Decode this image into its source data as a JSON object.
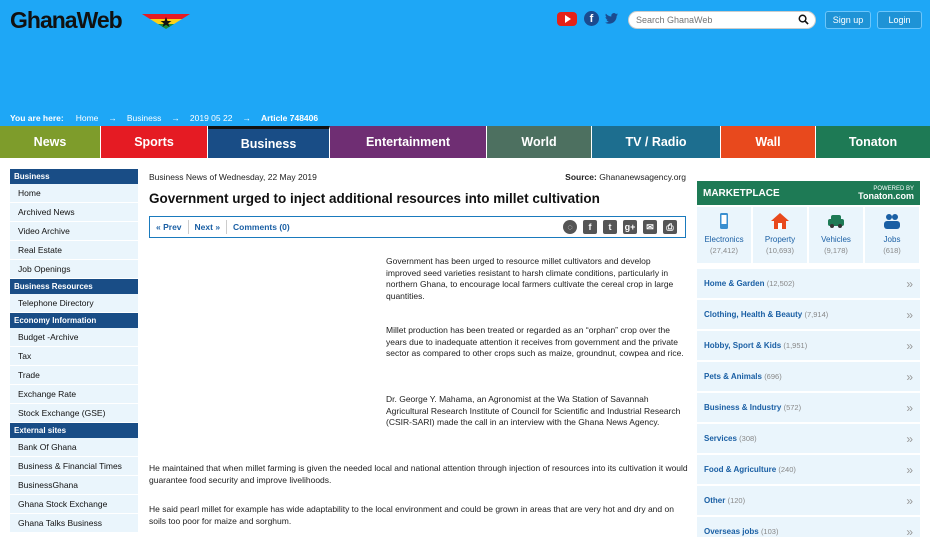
{
  "header": {
    "logo": "GhanaWeb",
    "search_placeholder": "Search GhanaWeb",
    "signup": "Sign up",
    "login": "Login",
    "social_icons": [
      "youtube-icon",
      "facebook-icon",
      "twitter-icon"
    ]
  },
  "breadcrumb": {
    "lead": "You are here:",
    "items": [
      "Home",
      "Business",
      "2019 05 22"
    ],
    "current": "Article 748406"
  },
  "nav": [
    {
      "label": "News",
      "color": "#7e9c2b"
    },
    {
      "label": "Sports",
      "color": "#e51b23"
    },
    {
      "label": "Business",
      "color": "#194d86"
    },
    {
      "label": "Entertainment",
      "color": "#6f2e73"
    },
    {
      "label": "World",
      "color": "#4d7060"
    },
    {
      "label": "TV / Radio",
      "color": "#1d6e8f"
    },
    {
      "label": "Wall",
      "color": "#e8491d"
    },
    {
      "label": "Tonaton",
      "color": "#1e7a55"
    }
  ],
  "sidebar": [
    {
      "heading": "Business",
      "items": [
        "Home",
        "Archived News",
        "Video Archive",
        "Real Estate",
        "Job Openings"
      ]
    },
    {
      "heading": "Business Resources",
      "items": [
        "Telephone Directory"
      ]
    },
    {
      "heading": "Economy Information",
      "items": [
        "Budget -Archive",
        "Tax",
        "Trade",
        "Exchange Rate",
        "Stock Exchange (GSE)"
      ]
    },
    {
      "heading": "External sites",
      "items": [
        "Bank Of Ghana",
        "Business & Financial Times",
        "BusinessGhana",
        "Ghana Stock Exchange",
        "Ghana Talks Business"
      ]
    }
  ],
  "article": {
    "meta_left": "Business News of Wednesday, 22 May 2019",
    "source_label": "Source:",
    "source_value": "Ghananewsagency.org",
    "title": "Government urged to inject additional resources into millet cultivation",
    "prev": "« Prev",
    "next": "Next »",
    "comments": "Comments (0)",
    "p1": "Government has been urged to resource millet cultivators and develop improved seed varieties resistant to harsh climate conditions, particularly in northern Ghana, to encourage local farmers cultivate the cereal crop in large quantities.",
    "p2": "Millet production has been treated or regarded as an “orphan” crop over the years due to inadequate attention it receives from government and the private sector as compared to other crops such as maize, groundnut, cowpea and rice.",
    "p3": "Dr. George Y. Mahama, an Agronomist at the Wa Station of Savannah Agricultural Research Institute of Council for Scientific and Industrial Research (CSIR-SARI) made the call in an interview with the Ghana News Agency.",
    "p4": "He maintained that when millet farming is given the needed local and national attention through injection of resources into its cultivation it would guarantee food security and improve livelihoods.",
    "p5": "He said pearl millet for example has wide adaptability to the local environment and could be grown in areas that are very hot and dry and on soils too poor for maize and sorghum."
  },
  "marketplace": {
    "title": "MARKETPLACE",
    "powered_by": "POWERED BY",
    "powered_name": "Tonaton.com",
    "top": [
      {
        "label": "Electronics",
        "count": "(27,412)",
        "icon": "phone-icon"
      },
      {
        "label": "Property",
        "count": "(10,693)",
        "icon": "house-icon"
      },
      {
        "label": "Vehicles",
        "count": "(9,178)",
        "icon": "car-icon"
      },
      {
        "label": "Jobs",
        "count": "(618)",
        "icon": "people-icon"
      }
    ],
    "rows": [
      {
        "label": "Home & Garden",
        "count": "(12,502)"
      },
      {
        "label": "Clothing, Health & Beauty",
        "count": "(7,914)"
      },
      {
        "label": "Hobby, Sport & Kids",
        "count": "(1,951)"
      },
      {
        "label": "Pets & Animals",
        "count": "(696)"
      },
      {
        "label": "Business & Industry",
        "count": "(572)"
      },
      {
        "label": "Services",
        "count": "(308)"
      },
      {
        "label": "Food & Agriculture",
        "count": "(240)"
      },
      {
        "label": "Other",
        "count": "(120)"
      },
      {
        "label": "Overseas jobs",
        "count": "(103)"
      }
    ]
  }
}
